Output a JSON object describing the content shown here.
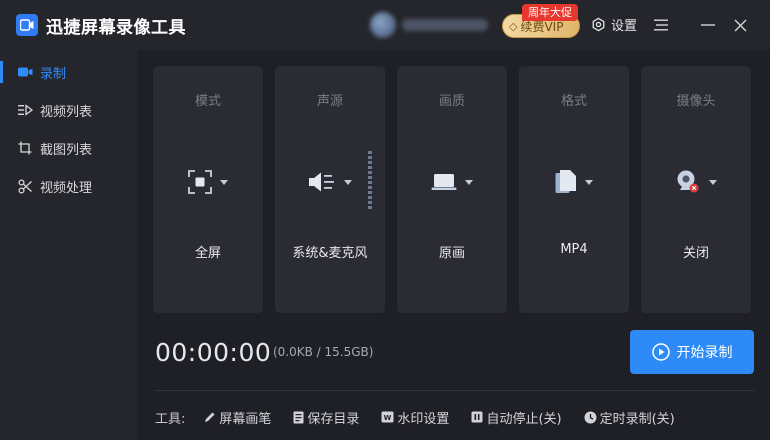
{
  "app": {
    "title": "迅捷屏幕录像工具"
  },
  "header": {
    "promo_tag": "周年大促",
    "vip_label": "续费VIP",
    "settings_label": "设置"
  },
  "sidebar": {
    "items": [
      {
        "label": "录制",
        "icon": "video-camera-icon",
        "active": true
      },
      {
        "label": "视频列表",
        "icon": "video-list-icon",
        "active": false
      },
      {
        "label": "截图列表",
        "icon": "screenshot-list-icon",
        "active": false
      },
      {
        "label": "视频处理",
        "icon": "video-edit-icon",
        "active": false
      }
    ]
  },
  "cards": [
    {
      "title": "模式",
      "value": "全屏",
      "icon": "fullscreen-icon"
    },
    {
      "title": "声源",
      "value": "系统&麦克风",
      "icon": "speaker-icon"
    },
    {
      "title": "画质",
      "value": "原画",
      "icon": "laptop-icon"
    },
    {
      "title": "格式",
      "value": "MP4",
      "icon": "file-icon"
    },
    {
      "title": "摄像头",
      "value": "关闭",
      "icon": "webcam-off-icon"
    }
  ],
  "recording": {
    "timer": "00:00:00",
    "size": "(0.0KB / 15.5GB)",
    "start_label": "开始录制"
  },
  "toolbar": {
    "label": "工具:",
    "items": [
      {
        "label": "屏幕画笔",
        "icon": "pen-icon"
      },
      {
        "label": "保存目录",
        "icon": "folder-doc-icon"
      },
      {
        "label": "水印设置",
        "icon": "watermark-icon"
      },
      {
        "label": "自动停止(关)",
        "icon": "pause-icon"
      },
      {
        "label": "定时录制(关)",
        "icon": "clock-icon"
      }
    ]
  },
  "colors": {
    "accent": "#2e8af6",
    "background": "#1f2026",
    "panel": "#2b2c33",
    "promo": "#e8372c",
    "vip_gold": "#e0b56a"
  }
}
